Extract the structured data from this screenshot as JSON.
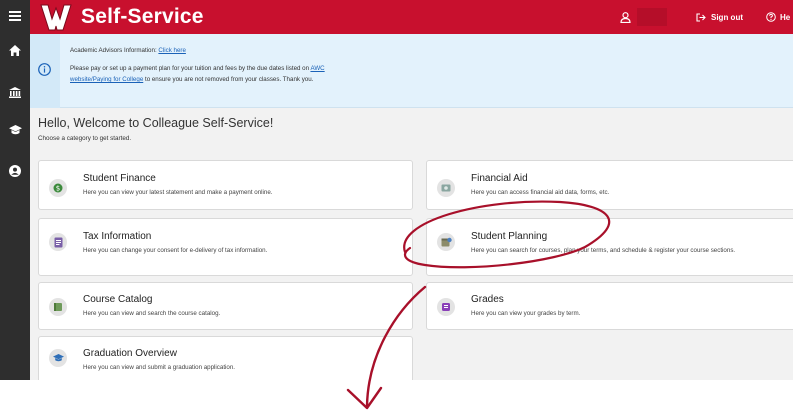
{
  "header": {
    "app_title": "Self-Service",
    "signout_label": "Sign out",
    "help_label": "He",
    "brand_color": "#c8102e"
  },
  "rail": {
    "items": [
      {
        "icon": "menu-icon"
      },
      {
        "icon": "home-icon"
      },
      {
        "icon": "bank-icon"
      },
      {
        "icon": "graduation-cap-icon"
      },
      {
        "icon": "user-circle-icon"
      }
    ],
    "color": "#2e2e2e"
  },
  "notice": {
    "line1_prefix": "Academic Advisors Information: ",
    "line1_link": "Click here",
    "line2_prefix": "Please pay or set up a payment plan for your tuition and fees by the due dates listed on ",
    "line2_link_a": "AWC",
    "line2_link_b": "website/Paying for College",
    "line2_suffix": " to ensure you are not removed from your classes.  Thank you.",
    "bg_color": "#e3f2fc"
  },
  "welcome": {
    "title": "Hello, Welcome to Colleague Self-Service!",
    "subtitle": "Choose a category to get started."
  },
  "cards": [
    {
      "title": "Student Finance",
      "description": "Here you can view your latest statement and make a payment online.",
      "icon": "dollar-icon"
    },
    {
      "title": "Financial Aid",
      "description": "Here you can access financial aid data, forms, etc.",
      "icon": "money-icon"
    },
    {
      "title": "Tax Information",
      "description": "Here you can change your consent for e-delivery of tax information.",
      "icon": "document-icon"
    },
    {
      "title": "Student Planning",
      "description": "Here you can search for courses, plan your terms, and schedule & register your course sections.",
      "icon": "calendar-icon"
    },
    {
      "title": "Course Catalog",
      "description": "Here you can view and search the course catalog.",
      "icon": "book-icon"
    },
    {
      "title": "Grades",
      "description": "Here you can view your grades by term.",
      "icon": "grades-icon"
    },
    {
      "title": "Graduation Overview",
      "description": "Here you can view and submit a graduation application.",
      "icon": "grad-cap-icon"
    }
  ],
  "annotation": {
    "color": "#a8102a",
    "highlighted_card": "Student Planning"
  }
}
